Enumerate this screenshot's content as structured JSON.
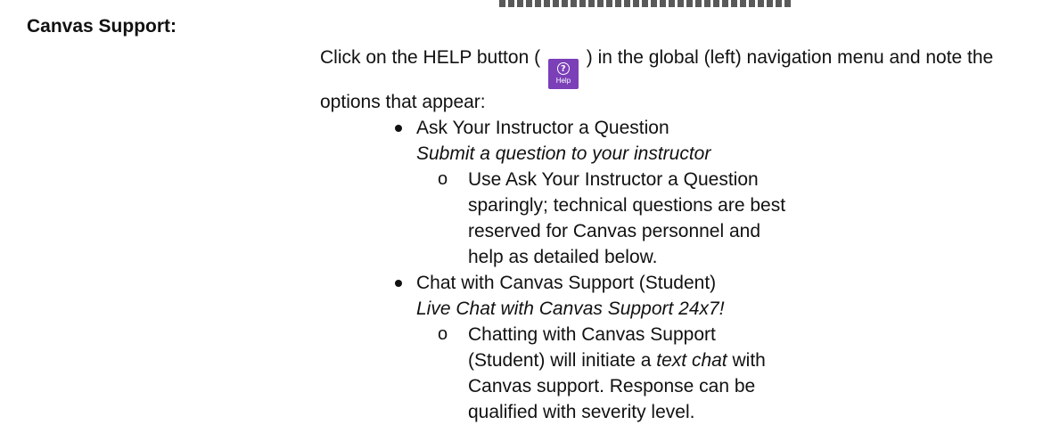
{
  "section_label": "Canvas Support:",
  "intro": {
    "before": "Click on the HELP button (",
    "after": ") in the global (left) navigation menu and note the options that appear:"
  },
  "help_button": {
    "glyph": "?",
    "label": "Help",
    "color": "#7b3fb8",
    "icon": "question-circle-icon"
  },
  "options": [
    {
      "title": "Ask Your Instructor a Question",
      "description": "Submit a question to your instructor",
      "note": {
        "before": "",
        "emphasis": "",
        "after": "Use Ask Your Instructor a Question sparingly; technical questions are best reserved for Canvas personnel and help as detailed below."
      }
    },
    {
      "title": "Chat with Canvas Support (Student)",
      "description": "Live Chat with Canvas Support 24x7!",
      "note": {
        "before": "Chatting with Canvas Support (Student) will initiate a ",
        "emphasis": "text chat",
        "after": " with Canvas support. Response can be qualified with severity level."
      }
    }
  ]
}
